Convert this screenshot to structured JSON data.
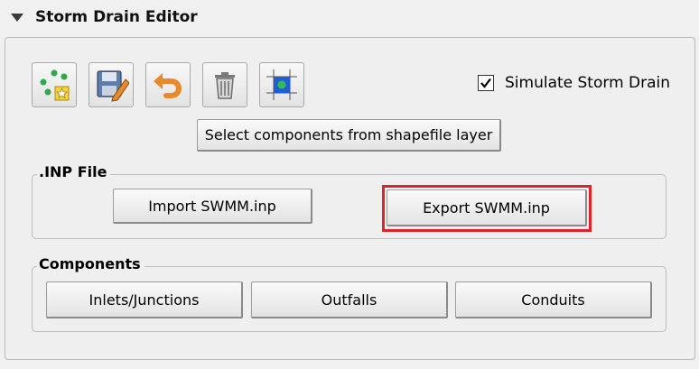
{
  "header": {
    "title": "Storm Drain Editor"
  },
  "toolbar": {
    "icons": [
      "points-star-icon",
      "save-edit-icon",
      "undo-icon",
      "trash-icon",
      "grid-cell-icon"
    ]
  },
  "simulate": {
    "label": "Simulate Storm Drain",
    "checked": true
  },
  "select_button": {
    "label": "Select components from shapefile layer"
  },
  "inp_group": {
    "title": ".INP File",
    "import_label": "Import SWMM.inp",
    "export_label": "Export SWMM.inp"
  },
  "components_group": {
    "title": "Components",
    "buttons": [
      "Inlets/Junctions",
      "Outfalls",
      "Conduits"
    ]
  },
  "colors": {
    "highlight": "#e0232a",
    "accent_blue": "#1f5fd6",
    "accent_green": "#2fa84a"
  }
}
